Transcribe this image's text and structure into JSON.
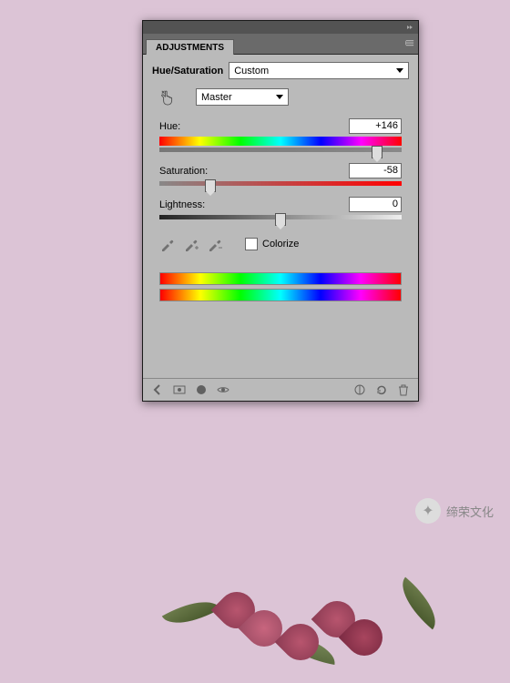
{
  "panel": {
    "tab_label": "ADJUSTMENTS",
    "title_label": "Hue/Saturation",
    "preset_value": "Custom",
    "channel_value": "Master",
    "sliders": {
      "hue": {
        "label": "Hue:",
        "value": "+146",
        "position_pct": 90
      },
      "saturation": {
        "label": "Saturation:",
        "value": "-58",
        "position_pct": 21
      },
      "lightness": {
        "label": "Lightness:",
        "value": "0",
        "position_pct": 50
      }
    },
    "colorize_label": "Colorize",
    "colorize_checked": false,
    "footer_icons": [
      "back-arrow-icon",
      "adjustment-layer-icon",
      "view-icon",
      "eye-icon",
      "clip-icon",
      "reset-icon",
      "trash-icon"
    ]
  },
  "watermark": {
    "text": "缔荣文化"
  }
}
